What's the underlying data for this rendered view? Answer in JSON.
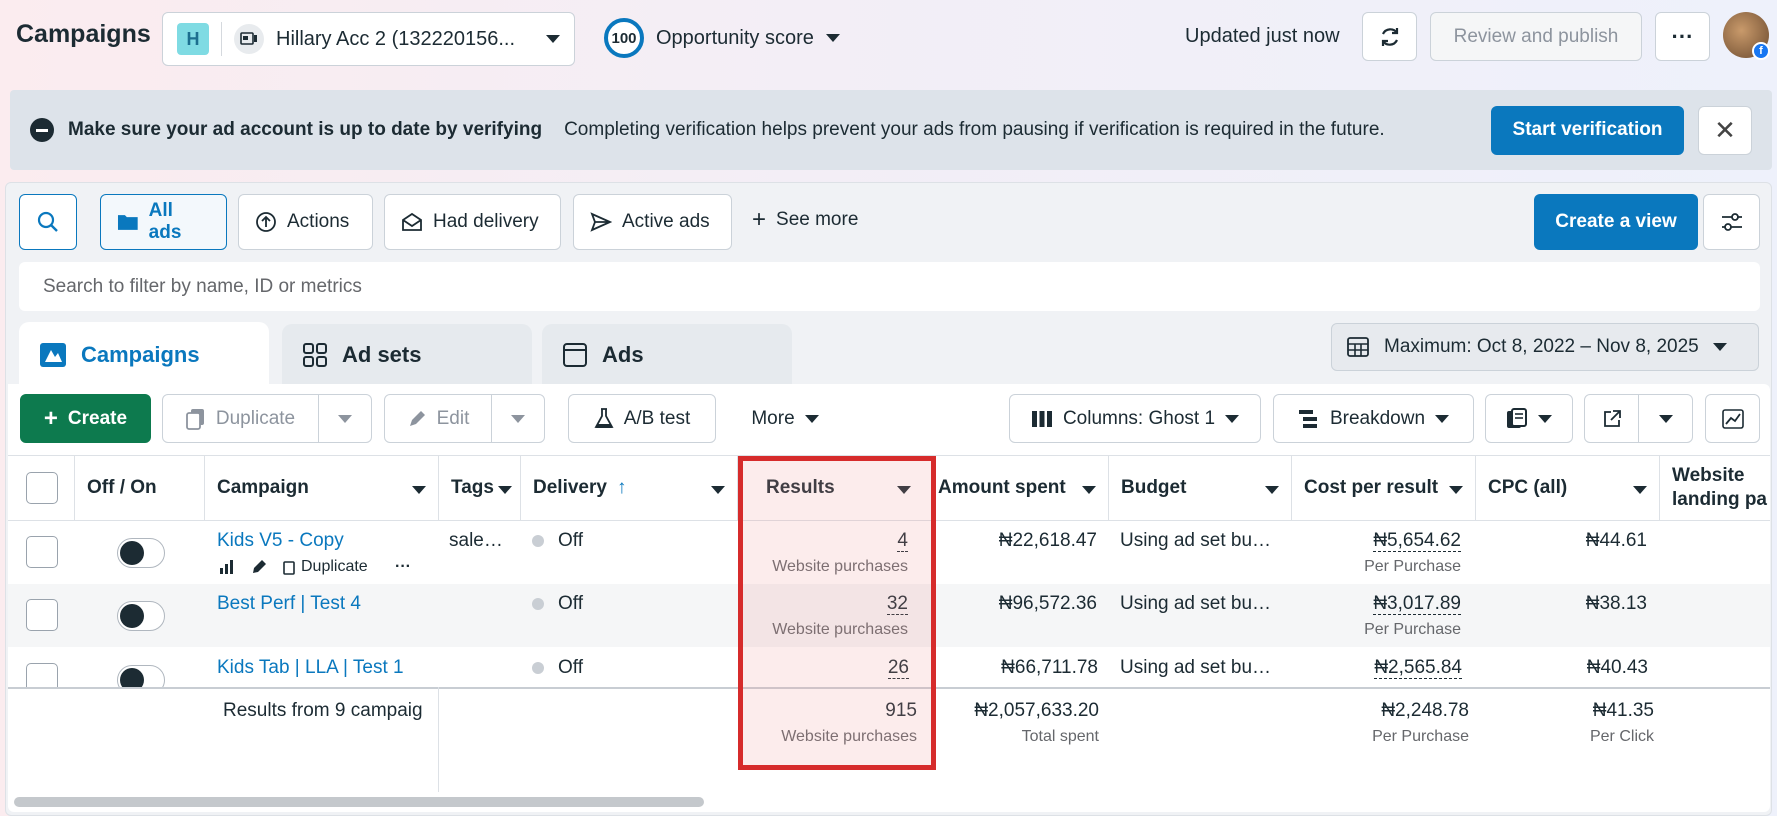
{
  "header": {
    "title": "Campaigns",
    "account_initial": "H",
    "account_label": "Hillary Acc 2 (132220156...",
    "score": "100",
    "score_label": "Opportunity score",
    "updated": "Updated just now",
    "review_label": "Review and publish",
    "more_label": "···",
    "profile_badge": "f"
  },
  "banner": {
    "title": "Make sure your ad account is up to date by verifying",
    "text": "Completing verification helps prevent your ads from pausing if verification is required in the future.",
    "button": "Start verification",
    "close": "✕"
  },
  "filters": {
    "all_ads": "All ads",
    "actions": "Actions",
    "had_delivery": "Had delivery",
    "active_ads": "Active ads",
    "see_more": "See more",
    "create_view": "Create a view",
    "search_placeholder": "Search to filter by name, ID or metrics"
  },
  "tabs": {
    "campaigns": "Campaigns",
    "adsets": "Ad sets",
    "ads": "Ads",
    "date_range": "Maximum: Oct 8, 2022 – Nov 8, 2025"
  },
  "toolbar": {
    "create": "Create",
    "duplicate": "Duplicate",
    "edit": "Edit",
    "ab_test": "A/B test",
    "more": "More",
    "columns": "Columns: Ghost 1",
    "breakdown": "Breakdown"
  },
  "columns": {
    "off_on": "Off / On",
    "campaign": "Campaign",
    "tags": "Tags",
    "delivery": "Delivery",
    "delivery_sort": "↑",
    "results": "Results",
    "amount_spent": "Amount spent",
    "budget": "Budget",
    "cost_per_result": "Cost per result",
    "cpc": "CPC (all)",
    "website_landing": "Website landing pa"
  },
  "rows": [
    {
      "campaign": "Kids V5 - Copy",
      "row_action": "Duplicate",
      "tags": "sale…",
      "delivery": "Off",
      "results": "4",
      "results_type": "Website purchases",
      "amount_spent": "₦22,618.47",
      "budget": "Using ad set bu…",
      "cost_per_result": "₦5,654.62",
      "cost_sub": "Per Purchase",
      "cpc": "₦44.61"
    },
    {
      "campaign": "Best Perf | Test 4",
      "tags": "",
      "delivery": "Off",
      "results": "32",
      "results_type": "Website purchases",
      "amount_spent": "₦96,572.36",
      "budget": "Using ad set bu…",
      "cost_per_result": "₦3,017.89",
      "cost_sub": "Per Purchase",
      "cpc": "₦38.13"
    },
    {
      "campaign": "Kids Tab | LLA | Test 1",
      "tags": "",
      "delivery": "Off",
      "results": "26",
      "amount_spent": "₦66,711.78",
      "budget": "Using ad set bu…",
      "cost_per_result": "₦2,565.84",
      "cpc": "₦40.43"
    }
  ],
  "totals": {
    "label": "Results from 9 campaig",
    "results": "915",
    "results_type": "Website purchases",
    "amount_spent": "₦2,057,633.20",
    "amount_sub": "Total spent",
    "cost_per_result": "₦2,248.78",
    "cost_sub": "Per Purchase",
    "cpc": "₦41.35",
    "cpc_sub": "Per Click"
  },
  "colors": {
    "accent": "#0a78be",
    "create_green": "#0d7a4e",
    "highlight": "#d62b2b"
  }
}
